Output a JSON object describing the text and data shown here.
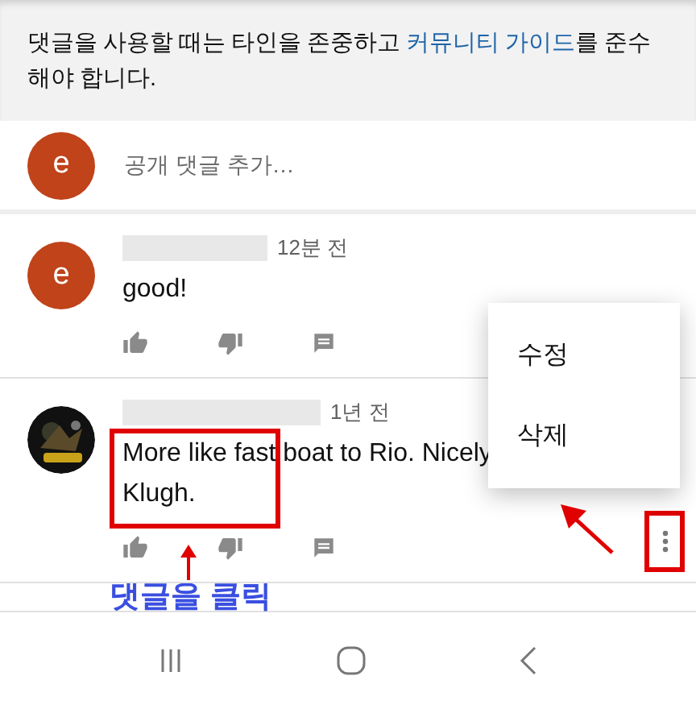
{
  "notice": {
    "text": "댓글을 사용할 때는 타인을 존중하고 ",
    "link": "커뮤니티 가이드",
    "text_end": "를 준수해야 합니다."
  },
  "composer": {
    "avatar_letter": "e",
    "placeholder": "공개 댓글 추가…"
  },
  "comments": [
    {
      "avatar": {
        "kind": "letter",
        "letter": "e"
      },
      "time": "12분 전",
      "text": "good!",
      "highlighted": false,
      "menu_open": false
    },
    {
      "time": "1년 전",
      "text": "More like fast boat to Rio. Nicely\nKlugh.",
      "highlighted": true,
      "menu_open": true
    }
  ],
  "menu": {
    "items": [
      "수정",
      "삭제"
    ]
  },
  "annotation": {
    "label": "댓글을 클릭"
  }
}
